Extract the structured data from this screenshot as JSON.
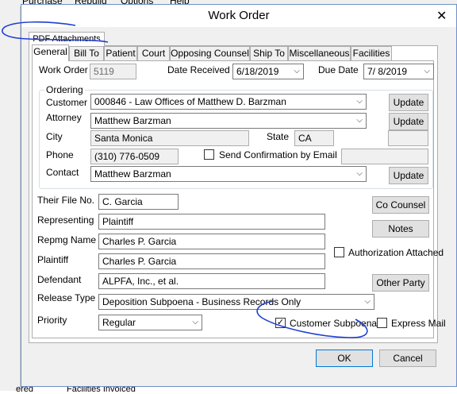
{
  "background": {
    "menu": [
      "Purchase",
      "Rebuild",
      "Options",
      "Help"
    ],
    "status": [
      "ered",
      "Facilities Invoiced"
    ]
  },
  "dialog": {
    "title": "Work Order"
  },
  "outer_tab": {
    "label": "PDF Attachments"
  },
  "tabs": [
    "General",
    "Bill To",
    "Patient",
    "Court",
    "Opposing Counsel",
    "Ship To",
    "Miscellaneous",
    "Facilities"
  ],
  "work_order": {
    "label": "Work Order",
    "value": "5119"
  },
  "date_received": {
    "label": "Date Received",
    "value": "6/18/2019"
  },
  "due_date": {
    "label": "Due Date",
    "value": "7/  8/2019"
  },
  "ordering": {
    "legend": "Ordering",
    "customer_label": "Customer",
    "customer_value": "000846 - Law Offices of Matthew D. Barzman",
    "attorney_label": "Attorney",
    "attorney_value": "Matthew Barzman",
    "city_label": "City",
    "city_value": "Santa Monica",
    "state_label": "State",
    "state_value": "CA",
    "phone_label": "Phone",
    "phone_value": "(310) 776-0509",
    "send_confirmation_label": "Send Confirmation by Email",
    "send_confirmation_checked": false,
    "contact_label": "Contact",
    "contact_value": "Matthew Barzman",
    "update_label": "Update"
  },
  "their_file": {
    "label": "Their File No.",
    "value": "C. Garcia"
  },
  "representing": {
    "label": "Representing",
    "value": "Plaintiff"
  },
  "repmg_name": {
    "label": "Repmg Name",
    "value": "Charles P. Garcia"
  },
  "plaintiff": {
    "label": "Plaintiff",
    "value": "Charles P. Garcia"
  },
  "defendant": {
    "label": "Defendant",
    "value": "ALPFA, Inc., et al."
  },
  "release_type": {
    "label": "Release Type",
    "value": "Deposition Subpoena - Business Records Only"
  },
  "priority": {
    "label": "Priority",
    "value": "Regular"
  },
  "authorization_attached": {
    "label": "Authorization Attached",
    "checked": false
  },
  "customer_subpoena": {
    "label": "Customer Subpoena",
    "checked": true
  },
  "express_mail": {
    "label": "Express Mail",
    "checked": false
  },
  "buttons": {
    "co_counsel": "Co Counsel",
    "notes": "Notes",
    "other_party": "Other Party",
    "ok": "OK",
    "cancel": "Cancel"
  },
  "check_mark": "✓",
  "close_glyph": "✕",
  "arrow_glyph": "⌵",
  "annotation_color": "#1f3fd0"
}
